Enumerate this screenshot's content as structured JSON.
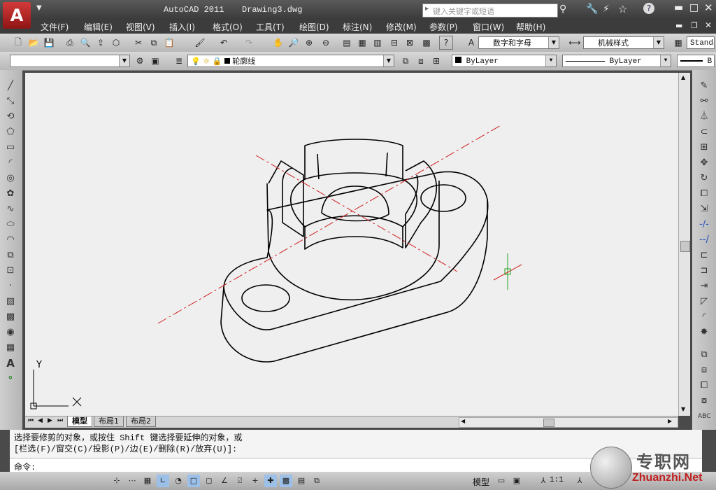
{
  "title": {
    "app": "AutoCAD 2011",
    "file": "Drawing3.dwg"
  },
  "search": {
    "placeholder": "键入关键字或短语"
  },
  "menus": [
    "文件(F)",
    "编辑(E)",
    "视图(V)",
    "插入(I)",
    "格式(O)",
    "工具(T)",
    "绘图(D)",
    "标注(N)",
    "修改(M)",
    "参数(P)",
    "窗口(W)",
    "帮助(H)"
  ],
  "styles": {
    "text_style": "数字和字母",
    "dim_style": "机械样式",
    "table_style": "Standa"
  },
  "layers": {
    "current": "轮廓线",
    "color": "ByLayer",
    "linetype": "ByLayer",
    "lineweight": "B"
  },
  "tabs": {
    "model": "模型",
    "layout1": "布局1",
    "layout2": "布局2"
  },
  "ucs": {
    "y": "Y",
    "x": "X"
  },
  "command": {
    "line1": "选择要修剪的对象，或按住 Shift 键选择要延伸的对象，或",
    "line2": "[栏选(F)/窗交(C)/投影(P)/边(E)/删除(R)/放弃(U)]:",
    "prompt": "命令:"
  },
  "status": {
    "model": "模型",
    "scale": "1:1"
  },
  "watermark": {
    "cn": "专职网",
    "en": "Zhuanzhi.Net"
  },
  "colors": {
    "accent": "#c8202a",
    "canvas": "#efefef",
    "centerline": "#d02020",
    "cursor": "#20a020"
  }
}
